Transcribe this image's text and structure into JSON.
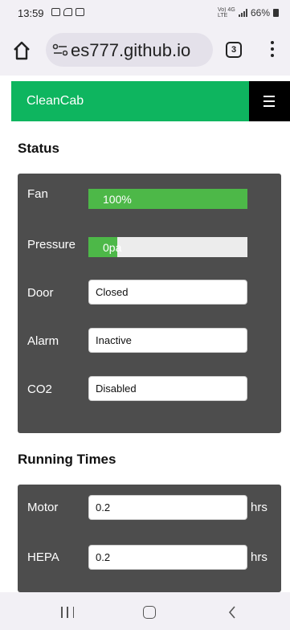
{
  "status_bar": {
    "time": "13:59",
    "network": "Vo) 4G LTE",
    "battery": "66%"
  },
  "browser": {
    "url": "es777.github.io",
    "tab_count": "3"
  },
  "navbar": {
    "brand": "CleanCab",
    "brand_color": "#0eb55f"
  },
  "status_section": {
    "title": "Status",
    "fan": {
      "label": "Fan",
      "value_text": "100%",
      "level": 1.0
    },
    "pressure": {
      "label": "Pressure",
      "value_text": "0pa",
      "level": 0.18
    },
    "door": {
      "label": "Door",
      "value": "Closed"
    },
    "alarm": {
      "label": "Alarm",
      "value": "Inactive"
    },
    "co2": {
      "label": "CO2",
      "value": "Disabled"
    }
  },
  "running_times": {
    "title": "Running Times",
    "motor": {
      "label": "Motor",
      "value": "0.2",
      "unit": "hrs"
    },
    "hepa": {
      "label": "HEPA",
      "value": "0.2",
      "unit": "hrs"
    }
  },
  "icons": [
    "home-icon",
    "site-settings-icon",
    "tabs-icon",
    "more-vert-icon",
    "menu-icon",
    "recents-icon",
    "nav-home-icon",
    "back-icon"
  ]
}
